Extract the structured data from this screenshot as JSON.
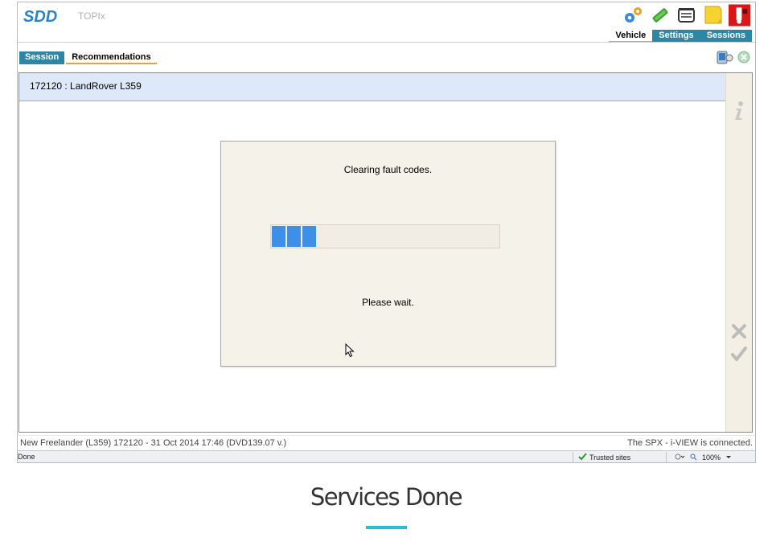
{
  "app": {
    "logo": "SDD",
    "product": "TOPIx"
  },
  "nav_tabs": [
    {
      "label": "Vehicle"
    },
    {
      "label": "Settings"
    },
    {
      "label": "Sessions"
    }
  ],
  "sub_tabs": [
    {
      "label": "Session"
    },
    {
      "label": "Recommendations"
    }
  ],
  "vehicle_bar": {
    "text": "172120 : LandRover L359"
  },
  "dialog": {
    "message": "Clearing fault codes.",
    "progress": 0.2,
    "wait_text": "Please wait."
  },
  "status": {
    "left": "New Freelander (L359) 172120 - 31 Oct 2014 17:46 (DVD139.07 v.)",
    "right": "The SPX - i-VIEW is connected."
  },
  "browser_status": {
    "done": "Done",
    "zone": "Trusted sites",
    "zoom": "100%"
  },
  "caption": "Services Done",
  "colors": {
    "accent": "#2e86a5",
    "tab_underline": "#f0a030",
    "progress": "#3d8fe8",
    "caption_rule": "#23c0dc"
  }
}
